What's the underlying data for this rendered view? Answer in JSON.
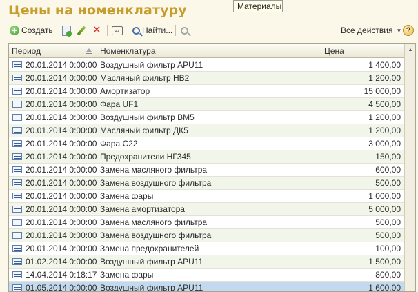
{
  "window": {
    "title": "Цены на номенклатуру",
    "tooltip": "Материалы"
  },
  "toolbar": {
    "create_label": "Создать",
    "find_label": "Найти...",
    "all_actions_label": "Все действия",
    "help_label": "?"
  },
  "table": {
    "columns": {
      "period": "Период",
      "nomenclature": "Номенклатура",
      "price": "Цена"
    },
    "rows": [
      {
        "period": "20.01.2014 0:00:00",
        "name": "Воздушный фильтр APU11",
        "price": "1 400,00"
      },
      {
        "period": "20.01.2014 0:00:00",
        "name": "Масляный фильтр НВ2",
        "price": "1 200,00"
      },
      {
        "period": "20.01.2014 0:00:00",
        "name": "Амортизатор",
        "price": "15 000,00"
      },
      {
        "period": "20.01.2014 0:00:00",
        "name": "Фара UF1",
        "price": "4 500,00"
      },
      {
        "period": "20.01.2014 0:00:00",
        "name": "Воздушный фильтр ВМ5",
        "price": "1 200,00"
      },
      {
        "period": "20.01.2014 0:00:00",
        "name": "Масляный фильтр ДК5",
        "price": "1 200,00"
      },
      {
        "period": "20.01.2014 0:00:00",
        "name": "Фара С22",
        "price": "3 000,00"
      },
      {
        "period": "20.01.2014 0:00:00",
        "name": "Предохранители НГ345",
        "price": "150,00"
      },
      {
        "period": "20.01.2014 0:00:00",
        "name": "Замена масляного фильтра",
        "price": "600,00"
      },
      {
        "period": "20.01.2014 0:00:00",
        "name": "Замена воздушного фильтра",
        "price": "500,00"
      },
      {
        "period": "20.01.2014 0:00:00",
        "name": "Замена фары",
        "price": "1 000,00"
      },
      {
        "period": "20.01.2014 0:00:00",
        "name": "Замена амортизатора",
        "price": "5 000,00"
      },
      {
        "period": "20.01.2014 0:00:00",
        "name": "Замена масляного фильтра",
        "price": "500,00"
      },
      {
        "period": "20.01.2014 0:00:00",
        "name": "Замена воздушного фильтра",
        "price": "500,00"
      },
      {
        "period": "20.01.2014 0:00:00",
        "name": "Замена предохранителей",
        "price": "100,00"
      },
      {
        "period": "01.02.2014 0:00:00",
        "name": "Воздушный фильтр APU11",
        "price": "1 500,00"
      },
      {
        "period": "14.04.2014 0:18:17",
        "name": "Замена фары",
        "price": "800,00"
      },
      {
        "period": "01.05.2014 0:00:00",
        "name": "Воздушный фильтр APU11",
        "price": "1 600,00"
      }
    ]
  },
  "colors": {
    "title": "#c79d2e",
    "selected_row": "#c3d9ee",
    "alt_row": "#f2f6ea"
  }
}
